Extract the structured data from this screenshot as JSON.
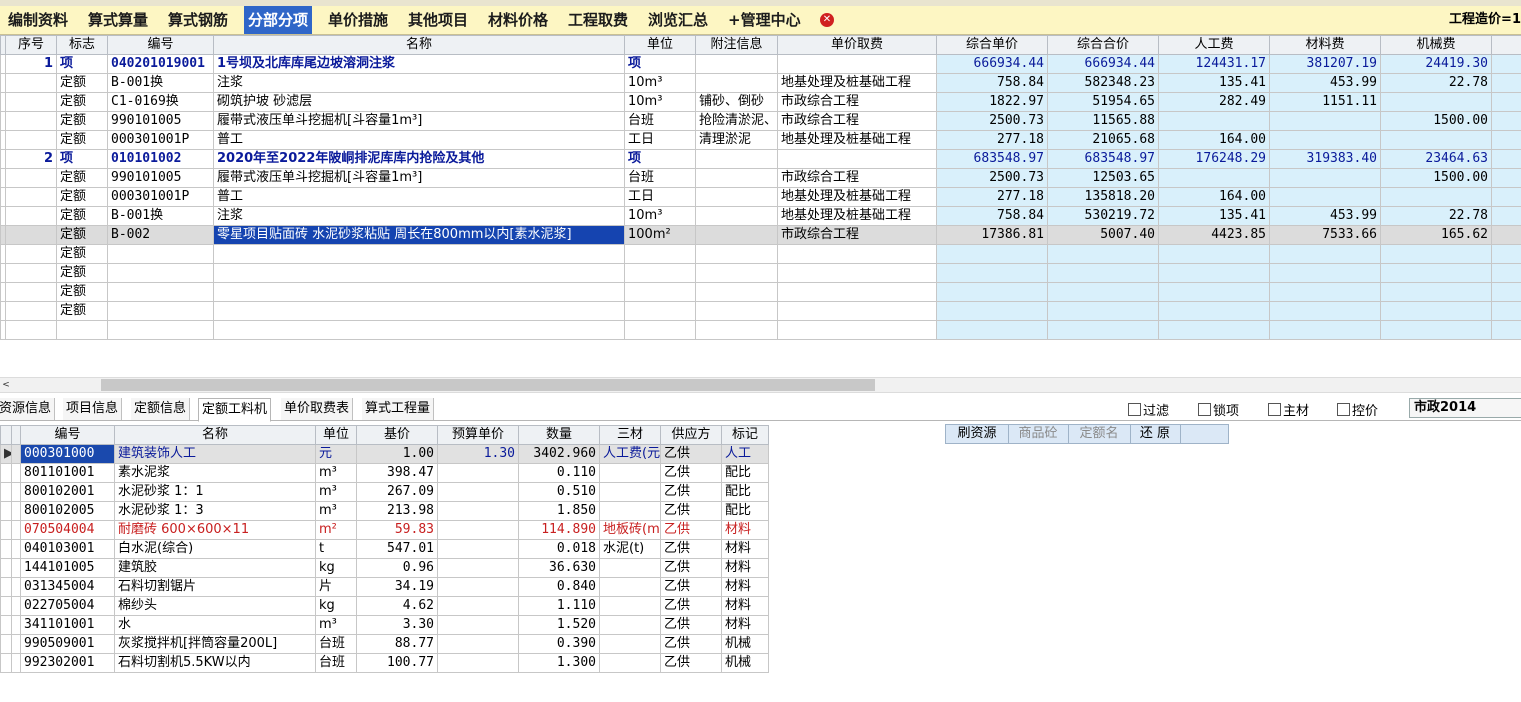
{
  "tabs": [
    {
      "label": "编制资料"
    },
    {
      "label": "算式算量"
    },
    {
      "label": "算式钢筋"
    },
    {
      "label": "分部分项"
    },
    {
      "label": "单价措施"
    },
    {
      "label": "其他项目"
    },
    {
      "label": "材料价格"
    },
    {
      "label": "工程取费"
    },
    {
      "label": "浏览汇总"
    },
    {
      "label": "+管理中心"
    }
  ],
  "close_icon_glyph": "✕",
  "project_cost_label": "工程造价=1",
  "top_grid": {
    "headers": [
      "序号",
      "标志",
      "编号",
      "名称",
      "单位",
      "附注信息",
      "单价取费",
      "综合单价",
      "综合合价",
      "人工费",
      "材料费",
      "机械费"
    ],
    "rows": [
      {
        "seq": "1",
        "flag": "项",
        "code": "040201019001",
        "name": "1号坝及北库库尾边坡溶洞注浆",
        "unit": "项",
        "note": "",
        "fee": "",
        "unit_price": "666934.44",
        "total": "666934.44",
        "labor": "124431.17",
        "material": "381207.19",
        "machine": "24419.30"
      },
      {
        "seq": "",
        "flag": "定额",
        "code": "B-001换",
        "name": "注浆",
        "unit": "10m³",
        "note": "",
        "fee": "地基处理及桩基础工程",
        "unit_price": "758.84",
        "total": "582348.23",
        "labor": "135.41",
        "material": "453.99",
        "machine": "22.78"
      },
      {
        "seq": "",
        "flag": "定额",
        "code": "C1-0169换",
        "name": "砌筑护坡 砂滤层",
        "unit": "10m³",
        "note": "铺砂、倒砂",
        "fee": "市政综合工程",
        "unit_price": "1822.97",
        "total": "51954.65",
        "labor": "282.49",
        "material": "1151.11",
        "machine": ""
      },
      {
        "seq": "",
        "flag": "定额",
        "code": "990101005",
        "name": "履带式液压单斗挖掘机[斗容量1m³]",
        "unit": "台班",
        "note": "抢险清淤泥、",
        "fee": "市政综合工程",
        "unit_price": "2500.73",
        "total": "11565.88",
        "labor": "",
        "material": "",
        "machine": "1500.00"
      },
      {
        "seq": "",
        "flag": "定额",
        "code": "000301001P",
        "name": "普工",
        "unit": "工日",
        "note": "清理淤泥",
        "fee": "地基处理及桩基础工程",
        "unit_price": "277.18",
        "total": "21065.68",
        "labor": "164.00",
        "material": "",
        "machine": ""
      },
      {
        "seq": "2",
        "flag": "项",
        "code": "010101002",
        "name": "2020年至2022年陂峒排泥库库内抢险及其他",
        "unit": "项",
        "note": "",
        "fee": "",
        "unit_price": "683548.97",
        "total": "683548.97",
        "labor": "176248.29",
        "material": "319383.40",
        "machine": "23464.63"
      },
      {
        "seq": "",
        "flag": "定额",
        "code": "990101005",
        "name": "履带式液压单斗挖掘机[斗容量1m³]",
        "unit": "台班",
        "note": "",
        "fee": "市政综合工程",
        "unit_price": "2500.73",
        "total": "12503.65",
        "labor": "",
        "material": "",
        "machine": "1500.00"
      },
      {
        "seq": "",
        "flag": "定额",
        "code": "000301001P",
        "name": "普工",
        "unit": "工日",
        "note": "",
        "fee": "地基处理及桩基础工程",
        "unit_price": "277.18",
        "total": "135818.20",
        "labor": "164.00",
        "material": "",
        "machine": ""
      },
      {
        "seq": "",
        "flag": "定额",
        "code": "B-001换",
        "name": "注浆",
        "unit": "10m³",
        "note": "",
        "fee": "地基处理及桩基础工程",
        "unit_price": "758.84",
        "total": "530219.72",
        "labor": "135.41",
        "material": "453.99",
        "machine": "22.78"
      },
      {
        "seq": "",
        "flag": "定额",
        "code": "B-002",
        "name": "零星项目贴面砖 水泥砂浆粘贴 周长在800mm以内[素水泥浆]",
        "unit": "100m²",
        "note": "",
        "fee": "市政综合工程",
        "unit_price": "17386.81",
        "total": "5007.40",
        "labor": "4423.85",
        "material": "7533.66",
        "machine": "165.62"
      },
      {
        "seq": "",
        "flag": "定额",
        "code": "",
        "name": "",
        "unit": "",
        "note": "",
        "fee": "",
        "unit_price": "",
        "total": "",
        "labor": "",
        "material": "",
        "machine": ""
      },
      {
        "seq": "",
        "flag": "定额",
        "code": "",
        "name": "",
        "unit": "",
        "note": "",
        "fee": "",
        "unit_price": "",
        "total": "",
        "labor": "",
        "material": "",
        "machine": ""
      },
      {
        "seq": "",
        "flag": "定额",
        "code": "",
        "name": "",
        "unit": "",
        "note": "",
        "fee": "",
        "unit_price": "",
        "total": "",
        "labor": "",
        "material": "",
        "machine": ""
      },
      {
        "seq": "",
        "flag": "定额",
        "code": "",
        "name": "",
        "unit": "",
        "note": "",
        "fee": "",
        "unit_price": "",
        "total": "",
        "labor": "",
        "material": "",
        "machine": ""
      },
      {
        "seq": "",
        "flag": "",
        "code": "",
        "name": "",
        "unit": "",
        "note": "",
        "fee": "",
        "unit_price": "",
        "total": "",
        "labor": "",
        "material": "",
        "machine": ""
      }
    ]
  },
  "scroll_left_glyph": "<",
  "lower_tabs": [
    {
      "label": "资源信息"
    },
    {
      "label": "项目信息"
    },
    {
      "label": "定额信息"
    },
    {
      "label": "定额工料机"
    },
    {
      "label": "单价取费表"
    },
    {
      "label": "算式工程量"
    }
  ],
  "checkboxes": [
    {
      "label": "过滤"
    },
    {
      "label": "锁项"
    },
    {
      "label": "主材"
    },
    {
      "label": "控价"
    }
  ],
  "region_select": "市政2014",
  "right_buttons": [
    {
      "label": "刷资源"
    },
    {
      "label": "商品砼"
    },
    {
      "label": "定额名"
    },
    {
      "label": "还 原"
    }
  ],
  "res_grid": {
    "headers": [
      "编号",
      "名称",
      "单位",
      "基价",
      "预算单价",
      "数量",
      "三材",
      "供应方",
      "标记"
    ],
    "rows": [
      {
        "code": "000301000",
        "name": "建筑装饰人工",
        "unit": "元",
        "base": "1.00",
        "budget": "1.30",
        "qty": "3402.960",
        "mat3": "人工费(元",
        "supplier": "乙供",
        "tag": "人工"
      },
      {
        "code": "801101001",
        "name": "素水泥浆",
        "unit": "m³",
        "base": "398.47",
        "budget": "",
        "qty": "0.110",
        "mat3": "",
        "supplier": "乙供",
        "tag": "配比"
      },
      {
        "code": "800102001",
        "name": "水泥砂浆 1：1",
        "unit": "m³",
        "base": "267.09",
        "budget": "",
        "qty": "0.510",
        "mat3": "",
        "supplier": "乙供",
        "tag": "配比"
      },
      {
        "code": "800102005",
        "name": "水泥砂浆 1：3",
        "unit": "m³",
        "base": "213.98",
        "budget": "",
        "qty": "1.850",
        "mat3": "",
        "supplier": "乙供",
        "tag": "配比"
      },
      {
        "code": "070504004",
        "name": "耐磨砖 600×600×11",
        "unit": "m²",
        "base": "59.83",
        "budget": "",
        "qty": "114.890",
        "mat3": "地板砖(m",
        "supplier": "乙供",
        "tag": "材料"
      },
      {
        "code": "040103001",
        "name": "白水泥(综合)",
        "unit": "t",
        "base": "547.01",
        "budget": "",
        "qty": "0.018",
        "mat3": "水泥(t)",
        "supplier": "乙供",
        "tag": "材料"
      },
      {
        "code": "144101005",
        "name": "建筑胶",
        "unit": "kg",
        "base": "0.96",
        "budget": "",
        "qty": "36.630",
        "mat3": "",
        "supplier": "乙供",
        "tag": "材料"
      },
      {
        "code": "031345004",
        "name": "石料切割锯片",
        "unit": "片",
        "base": "34.19",
        "budget": "",
        "qty": "0.840",
        "mat3": "",
        "supplier": "乙供",
        "tag": "材料"
      },
      {
        "code": "022705004",
        "name": "棉纱头",
        "unit": "kg",
        "base": "4.62",
        "budget": "",
        "qty": "1.110",
        "mat3": "",
        "supplier": "乙供",
        "tag": "材料"
      },
      {
        "code": "341101001",
        "name": "水",
        "unit": "m³",
        "base": "3.30",
        "budget": "",
        "qty": "1.520",
        "mat3": "",
        "supplier": "乙供",
        "tag": "材料"
      },
      {
        "code": "990509001",
        "name": "灰浆搅拌机[拌筒容量200L]",
        "unit": "台班",
        "base": "88.77",
        "budget": "",
        "qty": "0.390",
        "mat3": "",
        "supplier": "乙供",
        "tag": "机械"
      },
      {
        "code": "992302001",
        "name": "石料切割机5.5KW以内",
        "unit": "台班",
        "base": "100.77",
        "budget": "",
        "qty": "1.300",
        "mat3": "",
        "supplier": "乙供",
        "tag": "机械"
      }
    ]
  }
}
